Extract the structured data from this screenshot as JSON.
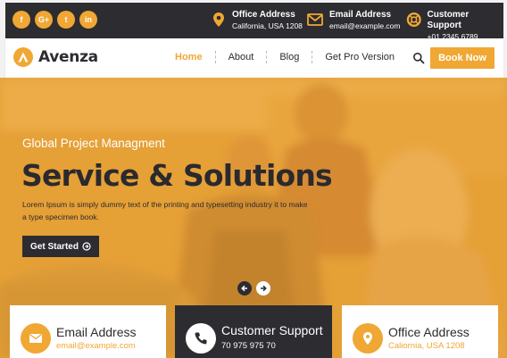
{
  "topbar": {
    "social": [
      {
        "icon": "facebook-icon",
        "glyph": "f"
      },
      {
        "icon": "google-plus-icon",
        "glyph": "G+"
      },
      {
        "icon": "twitter-icon",
        "glyph": "t"
      },
      {
        "icon": "linkedin-icon",
        "glyph": "in"
      }
    ],
    "office": {
      "title": "Office Address",
      "value": "California, USA 1208"
    },
    "email": {
      "title": "Email Address",
      "value": "email@example.com"
    },
    "support": {
      "title": "Customer Support",
      "value": "+01 2345 6789"
    }
  },
  "nav": {
    "logo": "Avenza",
    "menu": [
      "Home",
      "About",
      "Blog",
      "Get Pro Version"
    ],
    "active": "Home",
    "book_label": "Book Now"
  },
  "hero": {
    "subtitle": "Global Project Managment",
    "title": "Service & Solutions",
    "text": "Lorem Ipsum is simply dummy text of the printing and typesetting industry it to make a type specimen book.",
    "cta_label": "Get Started"
  },
  "cards": {
    "email": {
      "title": "Email Address",
      "value": "email@example.com"
    },
    "support": {
      "title": "Customer Support",
      "value": "70 975 975 70"
    },
    "office": {
      "title": "Office Address",
      "value": "Caliornia, USA 1208"
    }
  },
  "colors": {
    "accent": "#f0a733",
    "dark": "#2c2c31",
    "white": "#ffffff"
  }
}
